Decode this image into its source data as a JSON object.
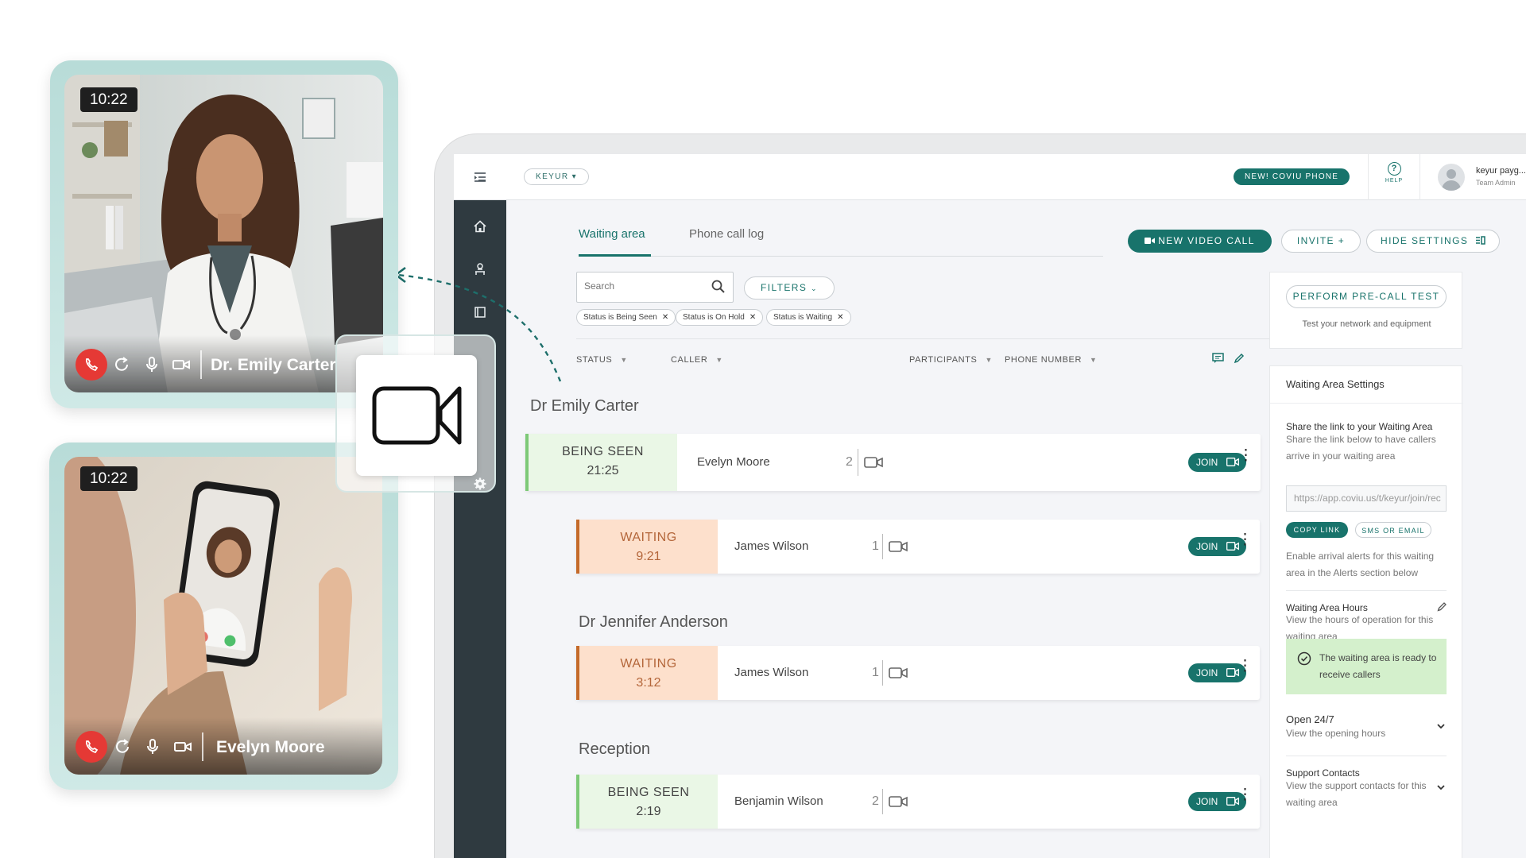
{
  "topbar": {
    "org": "KEYUR",
    "new_phone": "NEW! COVIU PHONE",
    "help": "HELP",
    "user_name": "keyur payg...",
    "user_role": "Team Admin"
  },
  "tabs": {
    "waiting": "Waiting area",
    "phone_log": "Phone call log"
  },
  "actions": {
    "new_video_call": "NEW VIDEO CALL",
    "invite": "INVITE +",
    "hide_settings": "HIDE SETTINGS"
  },
  "search": {
    "placeholder": "Search"
  },
  "filters": {
    "label": "FILTERS",
    "chips": [
      "Status is Being Seen",
      "Status is On Hold",
      "Status is Waiting"
    ]
  },
  "columns": [
    "STATUS",
    "CALLER",
    "PARTICIPANTS",
    "PHONE NUMBER"
  ],
  "groups": [
    {
      "title": "Dr Emily Carter",
      "rows": [
        {
          "status": "BEING SEEN",
          "time": "21:25",
          "caller": "Evelyn Moore",
          "participants": "2",
          "join": "JOIN"
        },
        {
          "status": "WAITING",
          "time": "9:21",
          "caller": "James Wilson",
          "participants": "1",
          "join": "JOIN"
        }
      ]
    },
    {
      "title": "Dr Jennifer Anderson",
      "rows": [
        {
          "status": "WAITING",
          "time": "3:12",
          "caller": "James Wilson",
          "participants": "1",
          "join": "JOIN"
        }
      ]
    },
    {
      "title": "Reception",
      "rows": [
        {
          "status": "BEING SEEN",
          "time": "2:19",
          "caller": "Benjamin Wilson",
          "participants": "2",
          "join": "JOIN"
        }
      ]
    }
  ],
  "panel": {
    "precall_button": "PERFORM PRE-CALL TEST",
    "precall_sub": "Test your network and equipment",
    "settings_title": "Waiting Area Settings",
    "share_title": "Share the link to your Waiting Area",
    "share_desc": "Share the link below to have callers arrive in your waiting area",
    "share_url": "https://app.coviu.us/t/keyur/join/rec",
    "copy_link": "COPY LINK",
    "sms_email": "SMS OR EMAIL",
    "alerts_desc": "Enable arrival alerts for this waiting area in the Alerts section below",
    "hours_title": "Waiting Area Hours",
    "hours_desc": "View the hours of operation for this waiting area",
    "ready_text": "The waiting area is ready to receive callers",
    "open_title": "Open 24/7",
    "open_desc": "View the opening hours",
    "support_title": "Support Contacts",
    "support_desc": "View the support contacts for this waiting area"
  },
  "video_cards": [
    {
      "timer": "10:22",
      "name": "Dr. Emily Carter"
    },
    {
      "timer": "10:22",
      "name": "Evelyn Moore"
    }
  ],
  "colors": {
    "brand": "#18736b",
    "being_seen": "#7dc977",
    "waiting": "#c46a2a",
    "end_call": "#e53935"
  }
}
